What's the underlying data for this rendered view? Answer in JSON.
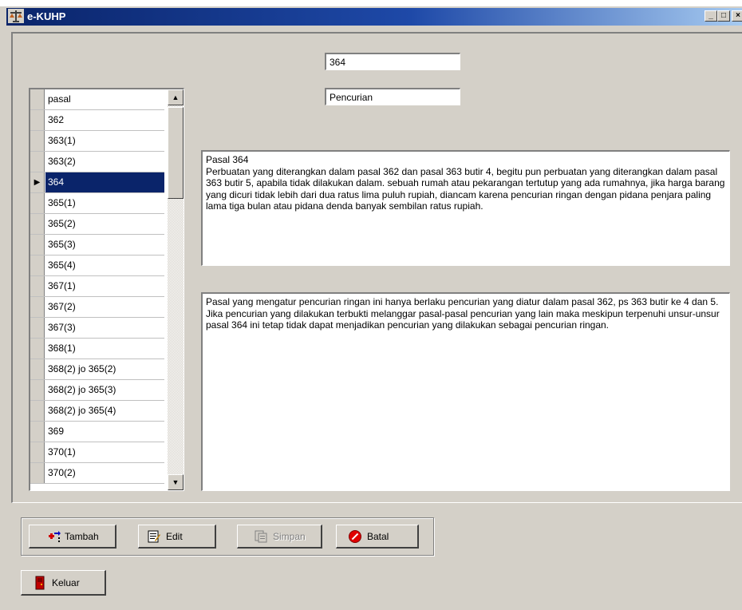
{
  "window": {
    "title": "e-KUHP",
    "controls": {
      "minimize": "_",
      "maximize": "□",
      "close": "×"
    }
  },
  "form": {
    "pasal_number": "364",
    "pasal_title": "Pencurian",
    "pasal_text": "Pasal 364\nPerbuatan yang diterangkan dalam pasal 362 dan pasal 363 butir 4, begitu pun perbuatan yang diterangkan dalam pasal 363 butir 5, apabila tidak dilakukan dalam. sebuah rumah atau pekarangan tertutup yang ada rumahnya, jika harga barang yang dicuri tidak lebih dari dua ratus lima puluh rupiah, diancam karena pencurian ringan dengan pidana penjara paling lama tiga bulan atau pidana denda banyak sembilan ratus rupiah.",
    "explanation_text": "Pasal yang mengatur pencurian ringan ini hanya berlaku pencurian yang diatur dalam pasal 362, ps 363 butir ke 4 dan 5. Jika pencurian yang dilakukan terbukti melanggar pasal-pasal pencurian yang lain maka meskipun terpenuhi unsur-unsur pasal 364 ini tetap tidak dapat menjadikan pencurian yang dilakukan sebagai pencurian ringan."
  },
  "grid": {
    "header": "pasal",
    "selected_index": 3,
    "rows": [
      "362",
      "363(1)",
      "363(2)",
      "364",
      "365(1)",
      "365(2)",
      "365(3)",
      "365(4)",
      "367(1)",
      "367(2)",
      "367(3)",
      "368(1)",
      "368(2) jo 365(2)",
      "368(2) jo 365(3)",
      "368(2) jo 365(4)",
      "369",
      "370(1)",
      "370(2)"
    ],
    "scroll_up": "▲",
    "scroll_down": "▼",
    "current_row_marker": "▶"
  },
  "buttons": {
    "tambah": "Tambah",
    "edit": "Edit",
    "simpan": "Simpan",
    "batal": "Batal",
    "keluar": "Keluar"
  },
  "icons": {
    "app": "scales-icon",
    "tambah": "add-record-icon",
    "edit": "edit-document-icon",
    "simpan": "save-document-icon",
    "batal": "cancel-icon",
    "keluar": "exit-door-icon"
  },
  "colors": {
    "title_gradient_start": "#0a246a",
    "selection": "#0a246a",
    "face": "#d4d0c8"
  }
}
